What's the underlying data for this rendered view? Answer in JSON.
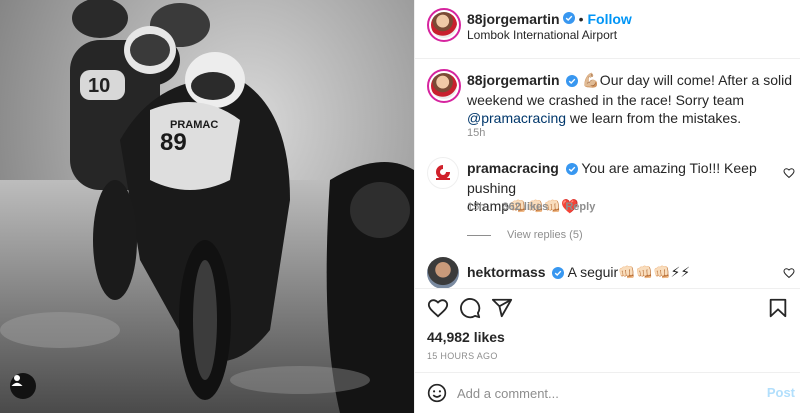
{
  "post": {
    "author": "88jorgemartin",
    "follow_label": "Follow",
    "separator": "•",
    "location": "Lombok International Airport",
    "caption_text": "💪🏼Our day will come! After a solid weekend we crashed in the race! Sorry team",
    "caption_mention": "@pramacracing",
    "caption_tail": "we learn from the mistakes.",
    "caption_time": "15h",
    "photo_alt": "Black and white photo of MotoGP riders racing in the wet"
  },
  "comments": [
    {
      "user": "pramacracing",
      "text_line1": "You are amazing Tio!!! Keep pushing",
      "text_line2": "champ👊🏻👊🏻👊🏻❤️",
      "time": "15h",
      "likes": "362 likes",
      "reply_label": "Reply",
      "view_replies": "View replies (5)"
    },
    {
      "user": "hektormass",
      "text": "A seguir👊🏻👊🏻👊🏻⚡⚡"
    }
  ],
  "actions": {
    "likes": "44,982 likes",
    "time_ago": "15 HOURS AGO"
  },
  "comment_box": {
    "placeholder": "Add a comment...",
    "post_label": "Post"
  },
  "colors": {
    "accent": "#0095f6",
    "verified": "#3897f0",
    "mention": "#00376b",
    "muted": "#8e8e8e",
    "post_disabled": "#b2dffc"
  }
}
